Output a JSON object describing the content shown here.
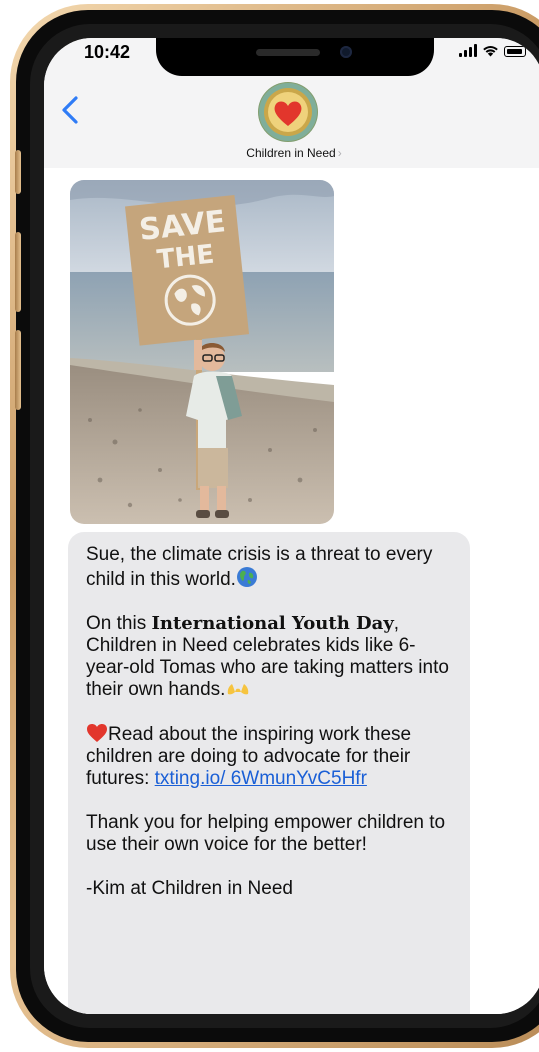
{
  "status_bar": {
    "time": "10:42"
  },
  "header": {
    "contact_name": "Children in Need",
    "back_icon": "chevron-left-icon",
    "avatar_icon": "heart-logo"
  },
  "message": {
    "p1": "Sue, the climate crisis is a threat to every child in this world.",
    "p2_prefix": "On this ",
    "p2_bold": "International Youth Day",
    "p2_suffix": ", Children in Need celebrates kids like 6-year-old Tomas who are taking matters into their own hands.",
    "p3": "Read about the inspiring work these children are doing to advocate for their futures: ",
    "p3_link": "txting.io/ 6WmunYvC5Hfr",
    "p4": "Thank you for helping empower children to use their own voice for the better!",
    "p5": "-Kim at Children in Need"
  },
  "photo": {
    "sign_line1": "SAVE",
    "sign_line2": "THE"
  },
  "colors": {
    "accent": "#1a5fd6",
    "bubble": "#e9e9eb",
    "header_bg": "#f4f4f5",
    "heart": "#e2362c"
  }
}
